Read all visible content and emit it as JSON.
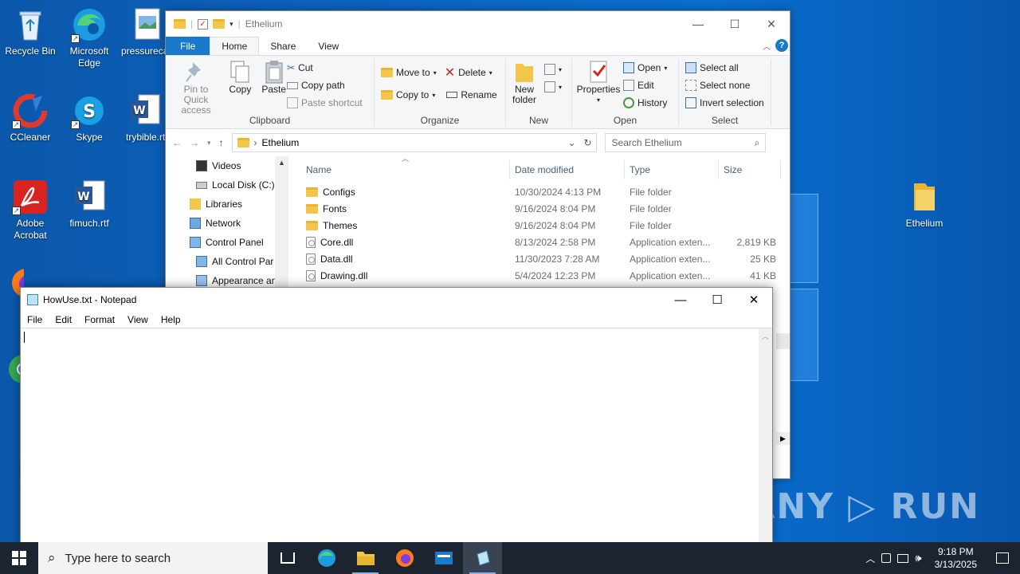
{
  "desktop": {
    "icons_left": [
      {
        "label": "Recycle Bin"
      },
      {
        "label": "Microsoft Edge"
      },
      {
        "label": "pressureca"
      },
      {
        "label": "CCleaner"
      },
      {
        "label": "Skype"
      },
      {
        "label": "trybible.rt"
      },
      {
        "label": "Adobe Acrobat"
      },
      {
        "label": "fimuch.rtf"
      }
    ],
    "icon_right": {
      "label": "Ethelium"
    },
    "watermark": "ANY ▷ RUN"
  },
  "explorer": {
    "title": "Ethelium",
    "tabs": [
      "File",
      "Home",
      "Share",
      "View"
    ],
    "ribbon": {
      "clipboard": {
        "pin": "Pin to Quick access",
        "copy": "Copy",
        "paste": "Paste",
        "cut": "Cut",
        "copy_path": "Copy path",
        "paste_shortcut": "Paste shortcut",
        "label": "Clipboard"
      },
      "organize": {
        "move_to": "Move to",
        "copy_to": "Copy to",
        "delete": "Delete",
        "rename": "Rename",
        "label": "Organize"
      },
      "new": {
        "new_folder": "New folder",
        "label": "New"
      },
      "open": {
        "properties": "Properties",
        "open": "Open",
        "edit": "Edit",
        "history": "History",
        "label": "Open"
      },
      "select": {
        "select_all": "Select all",
        "select_none": "Select none",
        "invert": "Invert selection",
        "label": "Select"
      }
    },
    "address": {
      "path": "Ethelium",
      "search_placeholder": "Search Ethelium"
    },
    "nav_items": [
      "Videos",
      "Local Disk (C:)",
      "Libraries",
      "Network",
      "Control Panel",
      "All Control Par",
      "Appearance an"
    ],
    "columns": {
      "name": "Name",
      "date": "Date modified",
      "type": "Type",
      "size": "Size"
    },
    "files": [
      {
        "name": "Configs",
        "date": "10/30/2024 4:13 PM",
        "type": "File folder",
        "size": "",
        "kind": "folder"
      },
      {
        "name": "Fonts",
        "date": "9/16/2024 8:04 PM",
        "type": "File folder",
        "size": "",
        "kind": "folder"
      },
      {
        "name": "Themes",
        "date": "9/16/2024 8:04 PM",
        "type": "File folder",
        "size": "",
        "kind": "folder"
      },
      {
        "name": "Core.dll",
        "date": "8/13/2024 2:58 PM",
        "type": "Application exten...",
        "size": "2,819 KB",
        "kind": "dll"
      },
      {
        "name": "Data.dll",
        "date": "11/30/2023 7:28 AM",
        "type": "Application exten...",
        "size": "25 KB",
        "kind": "dll"
      },
      {
        "name": "Drawing.dll",
        "date": "5/4/2024 12:23 PM",
        "type": "Application exten...",
        "size": "41 KB",
        "kind": "dll"
      }
    ]
  },
  "notepad": {
    "title": "HowUse.txt - Notepad",
    "menu": [
      "File",
      "Edit",
      "Format",
      "View",
      "Help"
    ],
    "content": ""
  },
  "taskbar": {
    "search_placeholder": "Type here to search",
    "time": "9:18 PM",
    "date": "3/13/2025"
  }
}
